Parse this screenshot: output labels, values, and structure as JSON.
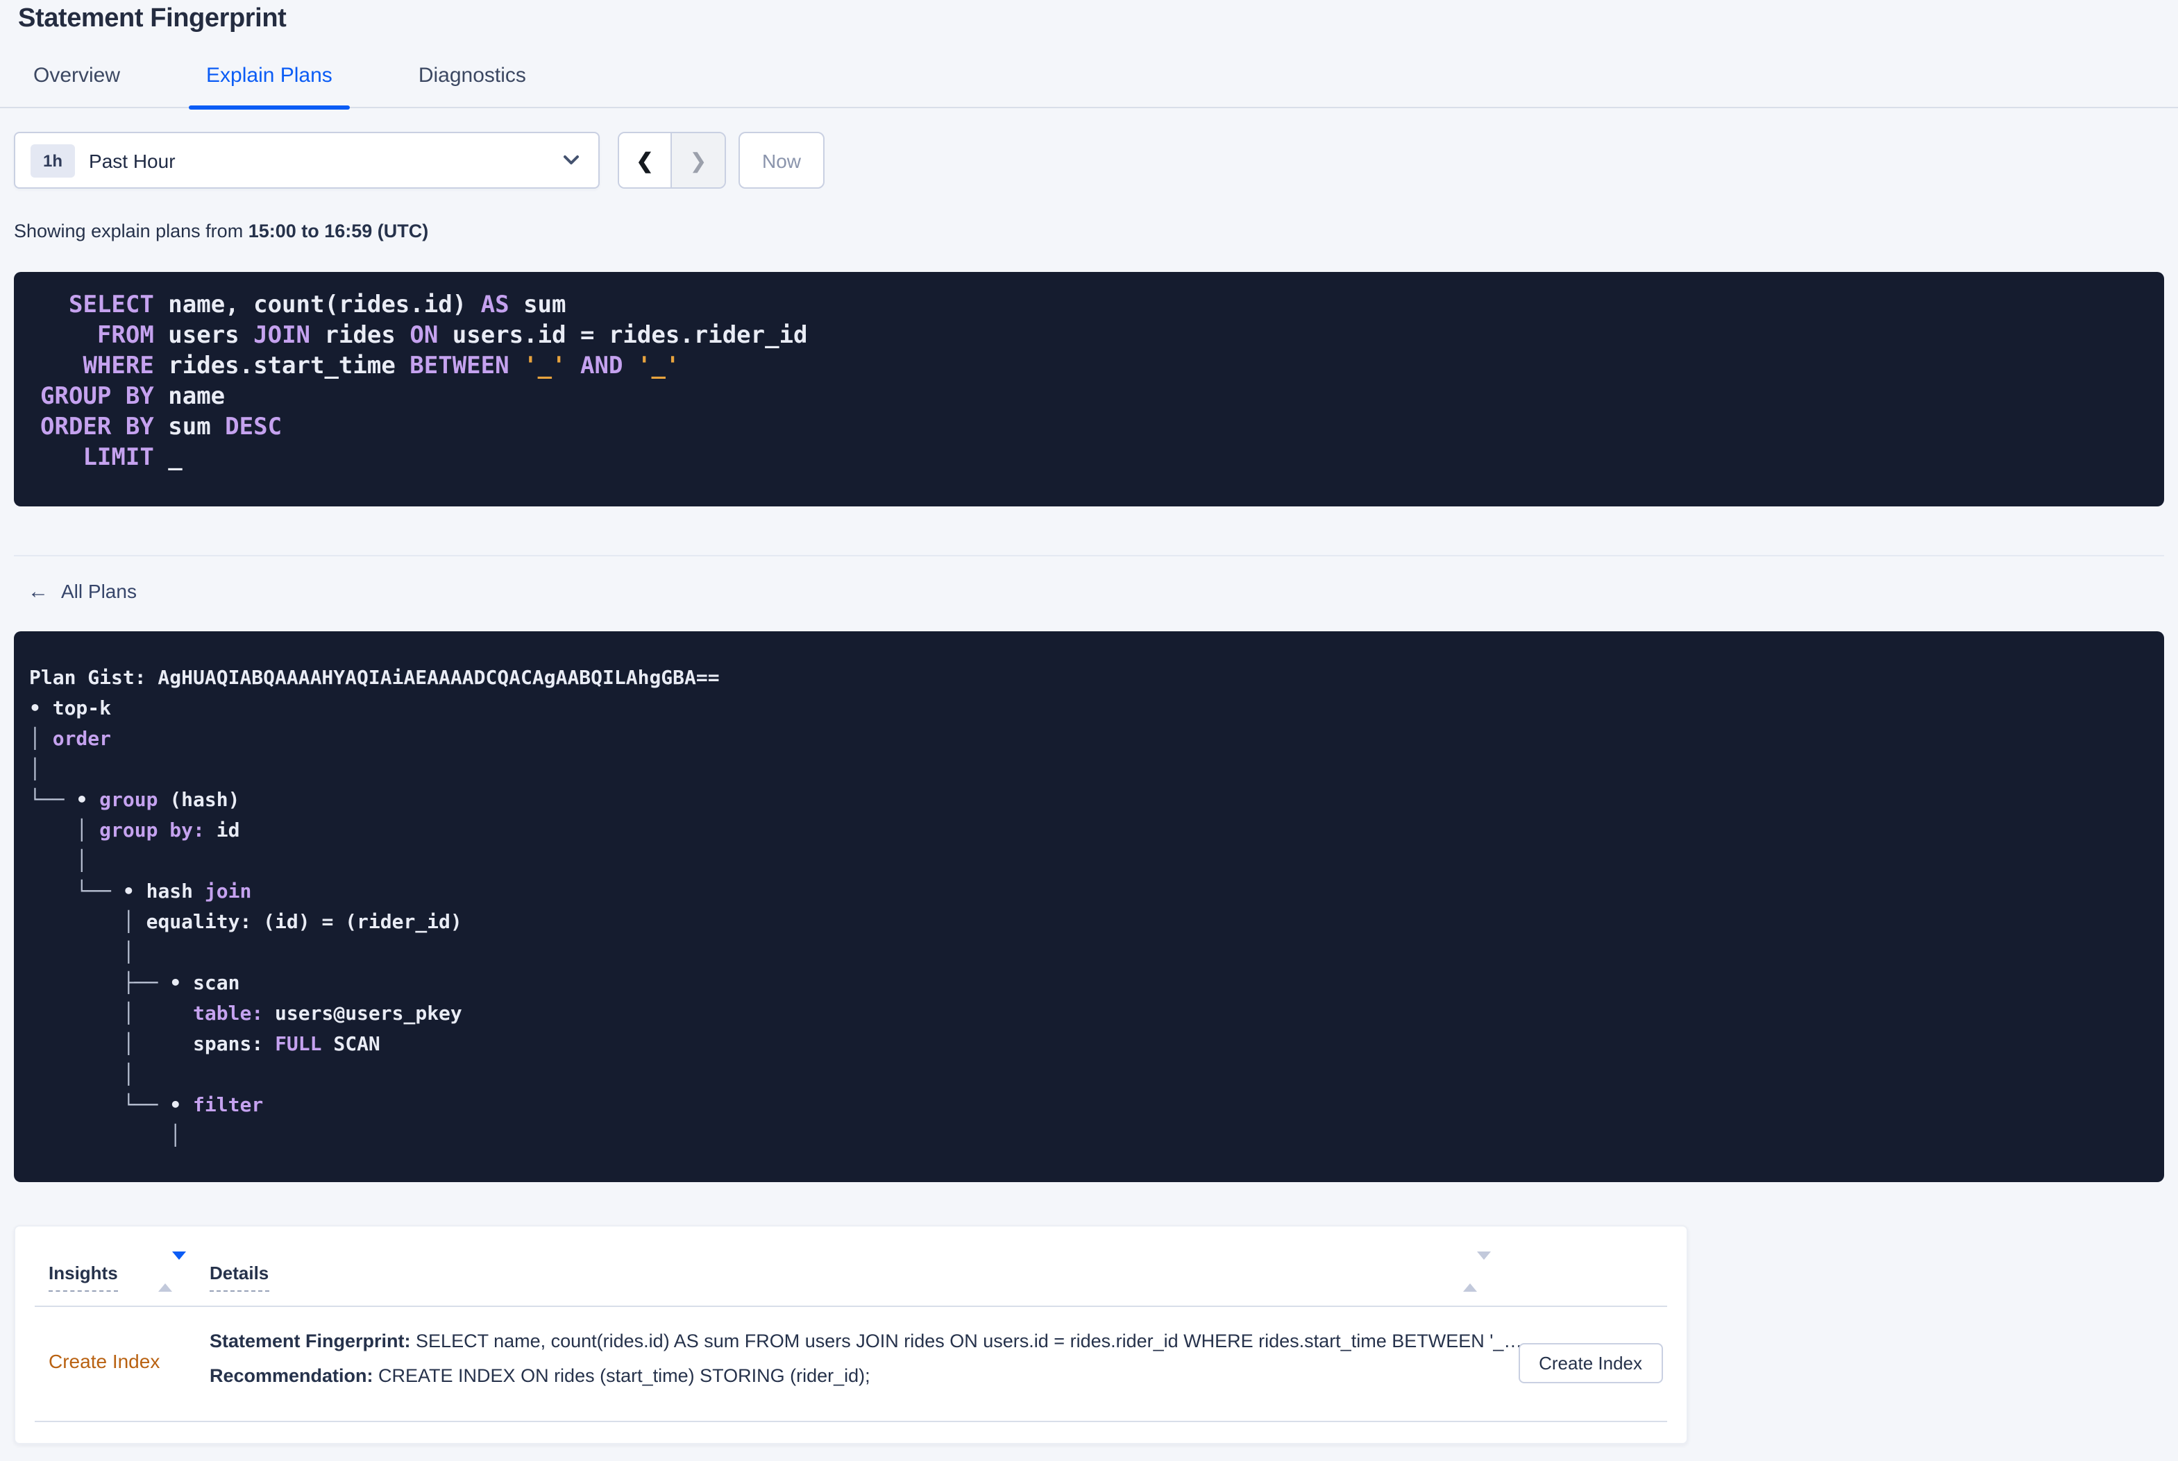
{
  "page": {
    "title": "Statement Fingerprint"
  },
  "tabs": [
    {
      "label": "Overview",
      "active": false
    },
    {
      "label": "Explain Plans",
      "active": true
    },
    {
      "label": "Diagnostics",
      "active": false
    }
  ],
  "time_picker": {
    "badge": "1h",
    "label": "Past Hour",
    "prev_icon": "❮",
    "next_icon": "❯",
    "now_label": "Now"
  },
  "status": {
    "prefix": "Showing explain plans from ",
    "range": "15:00 to 16:59 (UTC)"
  },
  "sql_query": {
    "lines": [
      [
        [
          "t",
          "  "
        ],
        [
          "k",
          "SELECT"
        ],
        [
          "t",
          " name, count(rides.id) "
        ],
        [
          "k",
          "AS"
        ],
        [
          "t",
          " sum"
        ]
      ],
      [
        [
          "t",
          "    "
        ],
        [
          "k",
          "FROM"
        ],
        [
          "t",
          " users "
        ],
        [
          "k",
          "JOIN"
        ],
        [
          "t",
          " rides "
        ],
        [
          "k",
          "ON"
        ],
        [
          "t",
          " users.id = rides.rider_id"
        ]
      ],
      [
        [
          "t",
          "   "
        ],
        [
          "k",
          "WHERE"
        ],
        [
          "t",
          " rides.start_time "
        ],
        [
          "k",
          "BETWEEN"
        ],
        [
          "t",
          " "
        ],
        [
          "o",
          "'_'"
        ],
        [
          "t",
          " "
        ],
        [
          "k",
          "AND"
        ],
        [
          "t",
          " "
        ],
        [
          "o",
          "'_'"
        ]
      ],
      [
        [
          "k",
          "GROUP BY"
        ],
        [
          "t",
          " name"
        ]
      ],
      [
        [
          "k",
          "ORDER BY"
        ],
        [
          "t",
          " sum "
        ],
        [
          "k",
          "DESC"
        ]
      ],
      [
        [
          "t",
          "   "
        ],
        [
          "k",
          "LIMIT"
        ],
        [
          "t",
          " _"
        ]
      ]
    ]
  },
  "back_link": {
    "icon": "←",
    "label": "All Plans"
  },
  "plan": {
    "gist_line": "Plan Gist: AgHUAQIABQAAAAHYAQIAiAEAAAADCQACAgAABQILAhgGBA==",
    "tree_lines": [
      [
        [
          "t",
          "• top-k"
        ]
      ],
      [
        [
          "d",
          "│ "
        ],
        [
          "k",
          "order"
        ]
      ],
      [
        [
          "d",
          "│"
        ]
      ],
      [
        [
          "d",
          "└── "
        ],
        [
          "t",
          "• "
        ],
        [
          "k",
          "group"
        ],
        [
          "t",
          " (hash)"
        ]
      ],
      [
        [
          "d",
          "    │ "
        ],
        [
          "k",
          "group by:"
        ],
        [
          "t",
          " id"
        ]
      ],
      [
        [
          "d",
          "    │"
        ]
      ],
      [
        [
          "d",
          "    └── "
        ],
        [
          "t",
          "• hash "
        ],
        [
          "k",
          "join"
        ]
      ],
      [
        [
          "d",
          "        │ "
        ],
        [
          "t",
          "equality: (id) = (rider_id)"
        ]
      ],
      [
        [
          "d",
          "        │"
        ]
      ],
      [
        [
          "d",
          "        ├── "
        ],
        [
          "t",
          "• scan"
        ]
      ],
      [
        [
          "d",
          "        │     "
        ],
        [
          "k",
          "table:"
        ],
        [
          "t",
          " users@users_pkey"
        ]
      ],
      [
        [
          "d",
          "        │     "
        ],
        [
          "t",
          "spans: "
        ],
        [
          "k",
          "FULL"
        ],
        [
          "t",
          " SCAN"
        ]
      ],
      [
        [
          "d",
          "        │"
        ]
      ],
      [
        [
          "d",
          "        └── "
        ],
        [
          "t",
          "• "
        ],
        [
          "k",
          "filter"
        ]
      ],
      [
        [
          "d",
          "            │"
        ]
      ]
    ]
  },
  "insights_table": {
    "columns": [
      "Insights",
      "Details"
    ],
    "row": {
      "insight_link": "Create Index",
      "fingerprint_label": "Statement Fingerprint:",
      "fingerprint_value": " SELECT name, count(rides.id) AS sum FROM users JOIN rides ON users.id = rides.rider_id WHERE rides.start_time BETWEEN '_…",
      "recommendation_label": "Recommendation:",
      "recommendation_value": " CREATE INDEX ON rides (start_time) STORING (rider_id);",
      "action_button": "Create Index"
    }
  },
  "colors": {
    "accent_blue": "#0B5CF5",
    "insight_link_orange": "#B96212",
    "code_background": "#151C2F",
    "code_keyword_purple": "#C5A2EF",
    "code_literal_orange": "#E8A33E",
    "page_background": "#F4F6FA"
  }
}
